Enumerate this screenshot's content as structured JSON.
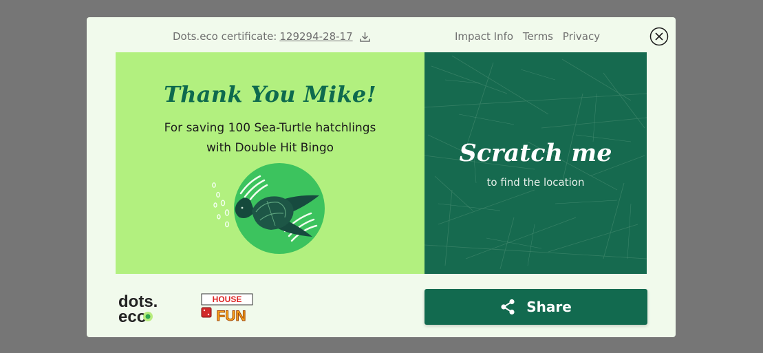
{
  "header": {
    "certificate_label": "Dots.eco certificate:",
    "certificate_code": "129294-28-17",
    "links": [
      "Impact Info",
      "Terms",
      "Privacy"
    ]
  },
  "card": {
    "thanks_title": "Thank You Mike!",
    "subtitle_line1": "For saving 100 Sea-Turtle hatchlings",
    "subtitle_line2": "with Double Hit Bingo",
    "scratch_title": "Scratch me",
    "scratch_subtitle": "to find the location"
  },
  "footer": {
    "dots_logo_line1": "dots.",
    "dots_logo_line2": "eco",
    "partner_logo_line1": "HOUSE",
    "partner_logo_line2": "FUN",
    "share_label": "Share"
  },
  "colors": {
    "overlay": "#767676",
    "modal_bg": "#f1faec",
    "light_green": "#b2f07f",
    "dark_green": "#166a4f",
    "brand_green": "#0e6a4e"
  },
  "icons": {
    "download": "download-icon",
    "close": "close-icon",
    "share": "share-icon"
  }
}
